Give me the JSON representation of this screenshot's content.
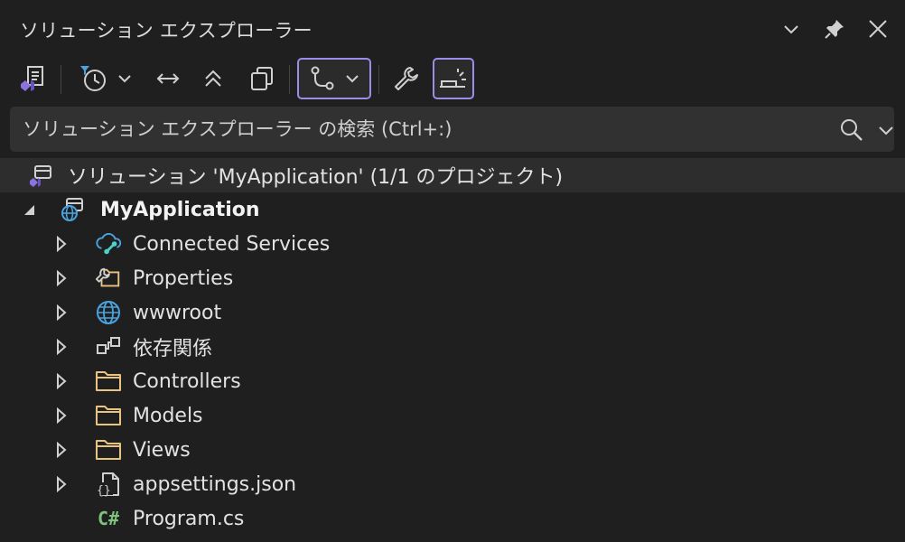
{
  "window": {
    "title": "ソリューション エクスプローラー"
  },
  "search": {
    "placeholder": "ソリューション エクスプローラー の検索 (Ctrl+:)"
  },
  "solution": {
    "label": "ソリューション 'MyApplication' (1/1 のプロジェクト)"
  },
  "project": {
    "label": "MyApplication"
  },
  "tree": {
    "items": [
      {
        "label": "Connected Services"
      },
      {
        "label": "Properties"
      },
      {
        "label": "wwwroot"
      },
      {
        "label": "依存関係"
      },
      {
        "label": "Controllers"
      },
      {
        "label": "Models"
      },
      {
        "label": "Views"
      },
      {
        "label": "appsettings.json"
      },
      {
        "label": "Program.cs"
      }
    ]
  },
  "icons": {
    "csharp": "C#",
    "accent": "#9d8ce8",
    "folder": "#e8c480",
    "globe": "#4aa3df",
    "csharp_color": "#7ec27e"
  }
}
